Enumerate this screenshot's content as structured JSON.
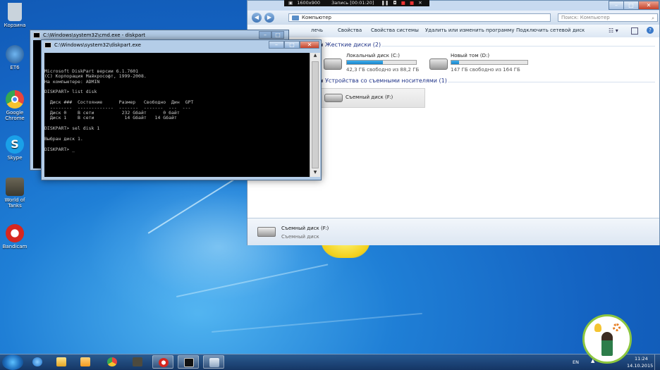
{
  "desktop_icons": [
    {
      "label": "Корзина",
      "icon": "recycle-bin-icon",
      "color": "#c9d3dc"
    },
    {
      "label": "ET6",
      "icon": "et6-icon",
      "color": "#1d4f8a"
    },
    {
      "label": "Google Chrome",
      "icon": "chrome-icon",
      "color": "#e8453c"
    },
    {
      "label": "Skype",
      "icon": "skype-icon",
      "color": "#1aa0e8"
    },
    {
      "label": "World of Tanks",
      "icon": "world-of-tanks-icon",
      "color": "#4d4a3e"
    },
    {
      "label": "Bandicam",
      "icon": "bandicam-icon",
      "color": "#d7271f"
    }
  ],
  "recorder": {
    "resolution": "1600x900",
    "status": "Запись [00:01:20]"
  },
  "explorer": {
    "address": "Компьютер",
    "search_placeholder": "Поиск: Компьютер",
    "toolbar": [
      "лечь",
      "Свойства",
      "Свойства системы",
      "Удалить или изменить программу",
      "Подключить сетевой диск"
    ],
    "hdd_group": "Жесткие диски (2)",
    "drives": [
      {
        "name": "Локальный диск (C:)",
        "free": "42,3 ГБ свободно из 88,2 ГБ",
        "used_fraction": 0.52
      },
      {
        "name": "Новый том (D:)",
        "free": "147 ГБ свободно из 164 ГБ",
        "used_fraction": 0.1
      }
    ],
    "removable_group": "Устройства со съемными носителями (1)",
    "removable": {
      "name": "Съемный диск (F:)"
    },
    "details": {
      "name": "Съемный диск (F:)",
      "type": "Съемный диск"
    }
  },
  "cmd_back": {
    "title": "C:\\Windows\\system32\\cmd.exe - diskpart"
  },
  "cmd_front": {
    "title": "C:\\Windows\\system32\\diskpart.exe",
    "lines": [
      "Microsoft DiskPart версии 6.1.7601",
      "(C) Корпорация Майкрософт, 1999-2008.",
      "На компьютере: ADMIN",
      "",
      "DISKPART> list disk",
      "",
      "  Диск ###  Состояние      Размер   Свободно  Дин  GPT",
      "  --------  -------------  -------  -------  ---  ---",
      "  Диск 0    В сети          232 Gбайт      0 байт",
      "  Диск 1    В сети           14 Gбайт   14 Gбайт",
      "",
      "DISKPART> sel disk 1",
      "",
      "Выбран диск 1.",
      "",
      "DISKPART> _"
    ]
  },
  "tray": {
    "lang": "EN",
    "time": "11:24",
    "date": "14.10.2015"
  }
}
